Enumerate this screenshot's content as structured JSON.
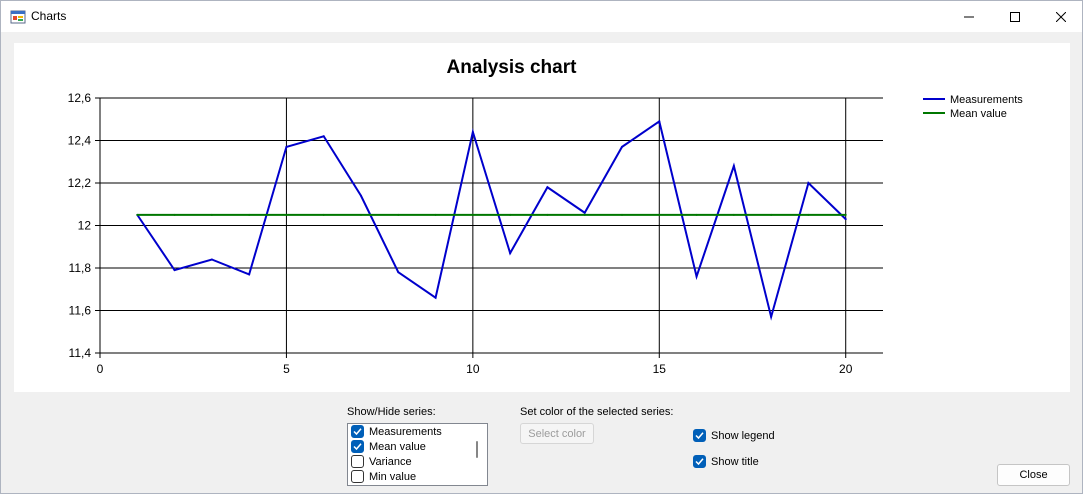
{
  "window": {
    "title": "Charts"
  },
  "chart_data": {
    "type": "line",
    "title": "Analysis chart",
    "xlabel": "",
    "ylabel": "",
    "xlim": [
      0,
      21
    ],
    "ylim": [
      11.4,
      12.6
    ],
    "x_ticks": [
      "0",
      "5",
      "10",
      "15",
      "20"
    ],
    "y_ticks": [
      "11,4",
      "11,6",
      "11,8",
      "12",
      "12,2",
      "12,4",
      "12,6"
    ],
    "grid": true,
    "legend_position": "top-right",
    "x": [
      1,
      2,
      3,
      4,
      5,
      6,
      7,
      8,
      9,
      10,
      11,
      12,
      13,
      14,
      15,
      16,
      17,
      18,
      19,
      20
    ],
    "series": [
      {
        "name": "Measurements",
        "color": "#0000cc",
        "values": [
          12.05,
          11.79,
          11.84,
          11.77,
          12.37,
          12.42,
          12.14,
          11.78,
          11.66,
          12.44,
          11.87,
          12.18,
          12.06,
          12.37,
          12.49,
          11.76,
          12.28,
          11.57,
          12.2,
          12.03
        ]
      },
      {
        "name": "Mean value",
        "color": "#007700",
        "values": [
          12.05,
          12.05,
          12.05,
          12.05,
          12.05,
          12.05,
          12.05,
          12.05,
          12.05,
          12.05,
          12.05,
          12.05,
          12.05,
          12.05,
          12.05,
          12.05,
          12.05,
          12.05,
          12.05,
          12.05
        ]
      }
    ]
  },
  "controls": {
    "show_hide_label": "Show/Hide series:",
    "series_items": [
      {
        "label": "Measurements",
        "checked": true
      },
      {
        "label": "Mean value",
        "checked": true
      },
      {
        "label": "Variance",
        "checked": false
      },
      {
        "label": "Min value",
        "checked": false
      }
    ],
    "set_color_label": "Set color of the selected series:",
    "select_color_button": "Select color",
    "show_legend": {
      "label": "Show legend",
      "checked": true
    },
    "show_title": {
      "label": "Show title",
      "checked": true
    },
    "close_button": "Close"
  }
}
